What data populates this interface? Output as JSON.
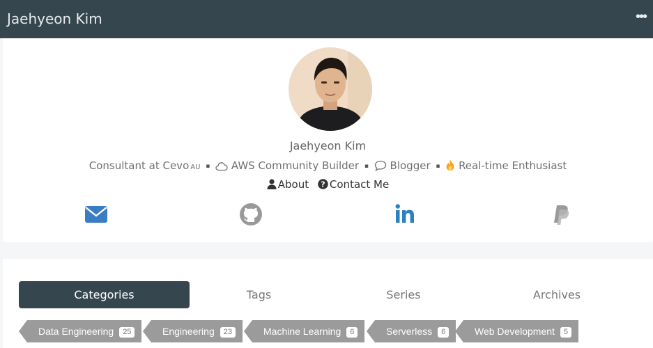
{
  "site": {
    "title": "Jaehyeon Kim"
  },
  "profile": {
    "name": "Jaehyeon Kim",
    "bio": {
      "role": "Consultant at Cevo",
      "role_sub": "AU",
      "sep": "▪",
      "aws": "AWS Community Builder",
      "blogger": "Blogger",
      "realtime": "Real-time Enthusiast"
    },
    "links": {
      "about": "About",
      "contact": "Contact Me"
    },
    "social": {
      "email_color": "#3b7dc4",
      "github_color": "#999999",
      "linkedin_color": "#2e7fc2",
      "paypal_color": "#9a9a9a"
    }
  },
  "nav": {
    "tabs": [
      {
        "label": "Categories",
        "active": true
      },
      {
        "label": "Tags"
      },
      {
        "label": "Series"
      },
      {
        "label": "Archives"
      }
    ]
  },
  "categories": [
    {
      "name": "Data Engineering",
      "count": "25"
    },
    {
      "name": "Engineering",
      "count": "23"
    },
    {
      "name": "Machine Learning",
      "count": "6"
    },
    {
      "name": "Serverless",
      "count": "6"
    },
    {
      "name": "Web Development",
      "count": "5"
    }
  ]
}
